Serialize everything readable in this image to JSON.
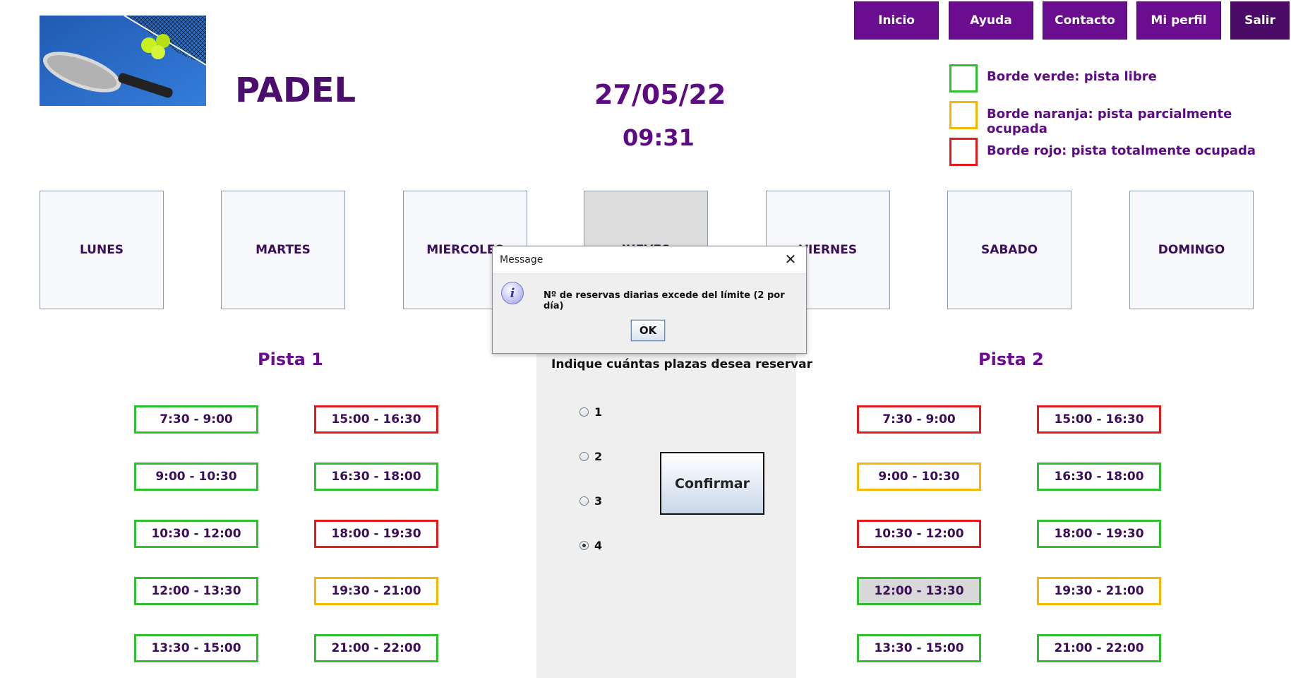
{
  "nav": {
    "items": [
      {
        "label": "Inicio"
      },
      {
        "label": "Ayuda"
      },
      {
        "label": "Contacto"
      },
      {
        "label": "Mi perfil"
      },
      {
        "label": "Salir"
      }
    ]
  },
  "header": {
    "title": "PADEL",
    "date": "27/05/22",
    "time": "09:31"
  },
  "legend": [
    {
      "label": "Borde verde: pista libre",
      "color": "#2fbf2f"
    },
    {
      "label": "Borde naranja: pista parcialmente ocupada",
      "color": "#f4b800"
    },
    {
      "label": "Borde rojo: pista totalmente ocupada",
      "color": "#e41b1b"
    }
  ],
  "days": [
    {
      "label": "LUNES"
    },
    {
      "label": "MARTES"
    },
    {
      "label": "MIERCOLES"
    },
    {
      "label": "JUEVES",
      "selected": true
    },
    {
      "label": "VIERNES"
    },
    {
      "label": "SABADO"
    },
    {
      "label": "DOMINGO"
    }
  ],
  "pista1": {
    "title": "Pista 1",
    "slots": [
      {
        "label": "7:30 - 9:00",
        "status": "green"
      },
      {
        "label": "9:00 - 10:30",
        "status": "green"
      },
      {
        "label": "10:30 - 12:00",
        "status": "green"
      },
      {
        "label": "12:00 - 13:30",
        "status": "green"
      },
      {
        "label": "13:30 - 15:00",
        "status": "green"
      },
      {
        "label": "15:00 - 16:30",
        "status": "red"
      },
      {
        "label": "16:30 - 18:00",
        "status": "green"
      },
      {
        "label": "18:00 - 19:30",
        "status": "red"
      },
      {
        "label": "19:30 - 21:00",
        "status": "orange"
      },
      {
        "label": "21:00 - 22:00",
        "status": "green"
      }
    ]
  },
  "pista2": {
    "title": "Pista 2",
    "slots": [
      {
        "label": "7:30 - 9:00",
        "status": "red"
      },
      {
        "label": "9:00 - 10:30",
        "status": "orange"
      },
      {
        "label": "10:30 - 12:00",
        "status": "red"
      },
      {
        "label": "12:00 - 13:30",
        "status": "green",
        "selected": true
      },
      {
        "label": "13:30 - 15:00",
        "status": "green"
      },
      {
        "label": "15:00 - 16:30",
        "status": "red"
      },
      {
        "label": "16:30 - 18:00",
        "status": "green"
      },
      {
        "label": "18:00 - 19:30",
        "status": "green"
      },
      {
        "label": "19:30 - 21:00",
        "status": "orange"
      },
      {
        "label": "21:00 - 22:00",
        "status": "green"
      }
    ]
  },
  "booking": {
    "question": "Indique cuántas plazas desea reservar",
    "options": [
      "1",
      "2",
      "3",
      "4"
    ],
    "selected_option": "4",
    "confirm_label": "Confirmar"
  },
  "dialog": {
    "title": "Message",
    "message": "Nº de reservas diarias excede del límite (2 por día)",
    "ok_label": "OK",
    "icon": "info-icon"
  }
}
